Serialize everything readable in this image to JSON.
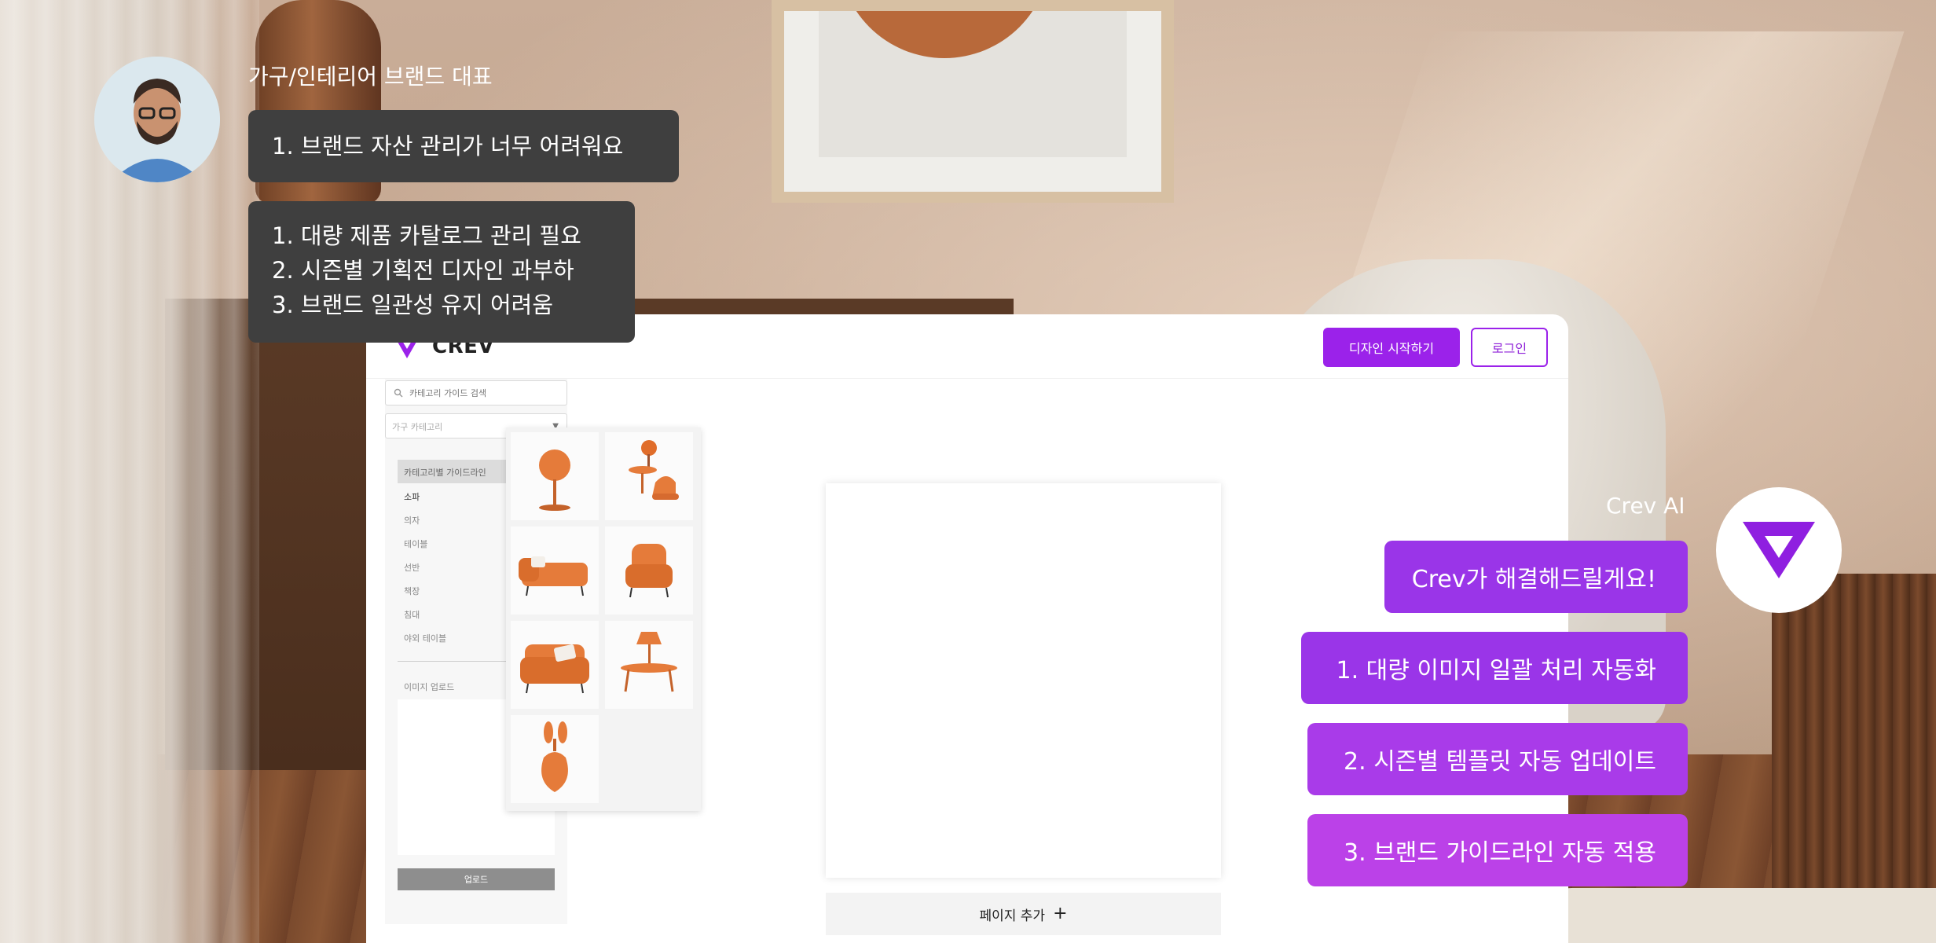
{
  "app": {
    "brand_name": "CREV",
    "start_design_label": "디자인 시작하기",
    "login_label": "로그인",
    "search_placeholder": "카테고리 가이드 검색",
    "category_select_value": "가구 카테고리",
    "category_header": "카테고리별 가이드라인",
    "categories": [
      "소파",
      "의자",
      "테이블",
      "선반",
      "책장",
      "침대",
      "야외 테이블"
    ],
    "upload_label": "이미지 업로드",
    "upload_button": "업로드",
    "add_page_label": "페이지 추가",
    "popup_items": [
      "round-mirror",
      "side-table-with-chair",
      "sofa",
      "armchair",
      "loveseat",
      "lamp-table",
      "vase"
    ]
  },
  "chat": {
    "user_label": "가구/인테리어 브랜드 대표",
    "user_message_1": "1. 브랜드 자산 관리가 너무 어려워요",
    "user_message_2": [
      "1. 대량 제품 카탈로그 관리 필요",
      "2. 시즌별 기획전 디자인 과부하",
      "3. 브랜드 일관성 유지 어려움"
    ],
    "ai_label": "Crev AI",
    "ai_messages": [
      "Crev가 해결해드릴게요!",
      "1. 대량 이미지 일괄 처리 자동화",
      "2. 시즌별 템플릿 자동 업데이트",
      "3. 브랜드 가이드라인 자동 적용"
    ]
  },
  "colors": {
    "accent": "#9b22ea",
    "dark_bubble": "#3f3f3f",
    "ai_bubble": "#9a35e8",
    "furniture_orange": "#e57b3a"
  }
}
